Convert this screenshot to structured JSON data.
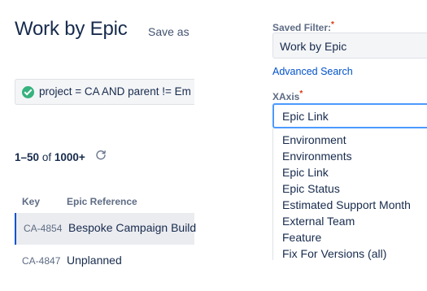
{
  "header": {
    "title": "Work by Epic",
    "save_as": "Save as"
  },
  "jql": {
    "query": "project = CA AND parent != Em",
    "status_icon": "check-circle-icon",
    "status_color": "#36b37e"
  },
  "results": {
    "range": "1–50",
    "of_label": "of",
    "total": "1000+",
    "refresh_icon": "refresh-icon"
  },
  "table": {
    "columns": [
      "Key",
      "Epic Reference"
    ],
    "rows": [
      {
        "key": "CA-4854",
        "epic": "Bespoke Campaign Build"
      },
      {
        "key": "CA-4847",
        "epic": "Unplanned"
      }
    ]
  },
  "saved_filter": {
    "label": "Saved Filter:",
    "required_mark": "*",
    "value": "Work by Epic"
  },
  "advanced_search": "Advanced Search",
  "xaxis": {
    "label": "XAxis",
    "required_mark": "*",
    "value": "Epic Link",
    "options": [
      "Environment",
      "Environments",
      "Epic Link",
      "Epic Status",
      "Estimated Support Month",
      "External Team",
      "Feature",
      "Fix For Versions (all)"
    ]
  },
  "colors": {
    "link": "#0052cc",
    "focus_border": "#4c9aff",
    "required": "#de350b",
    "selected_row": "#ebecf0"
  }
}
